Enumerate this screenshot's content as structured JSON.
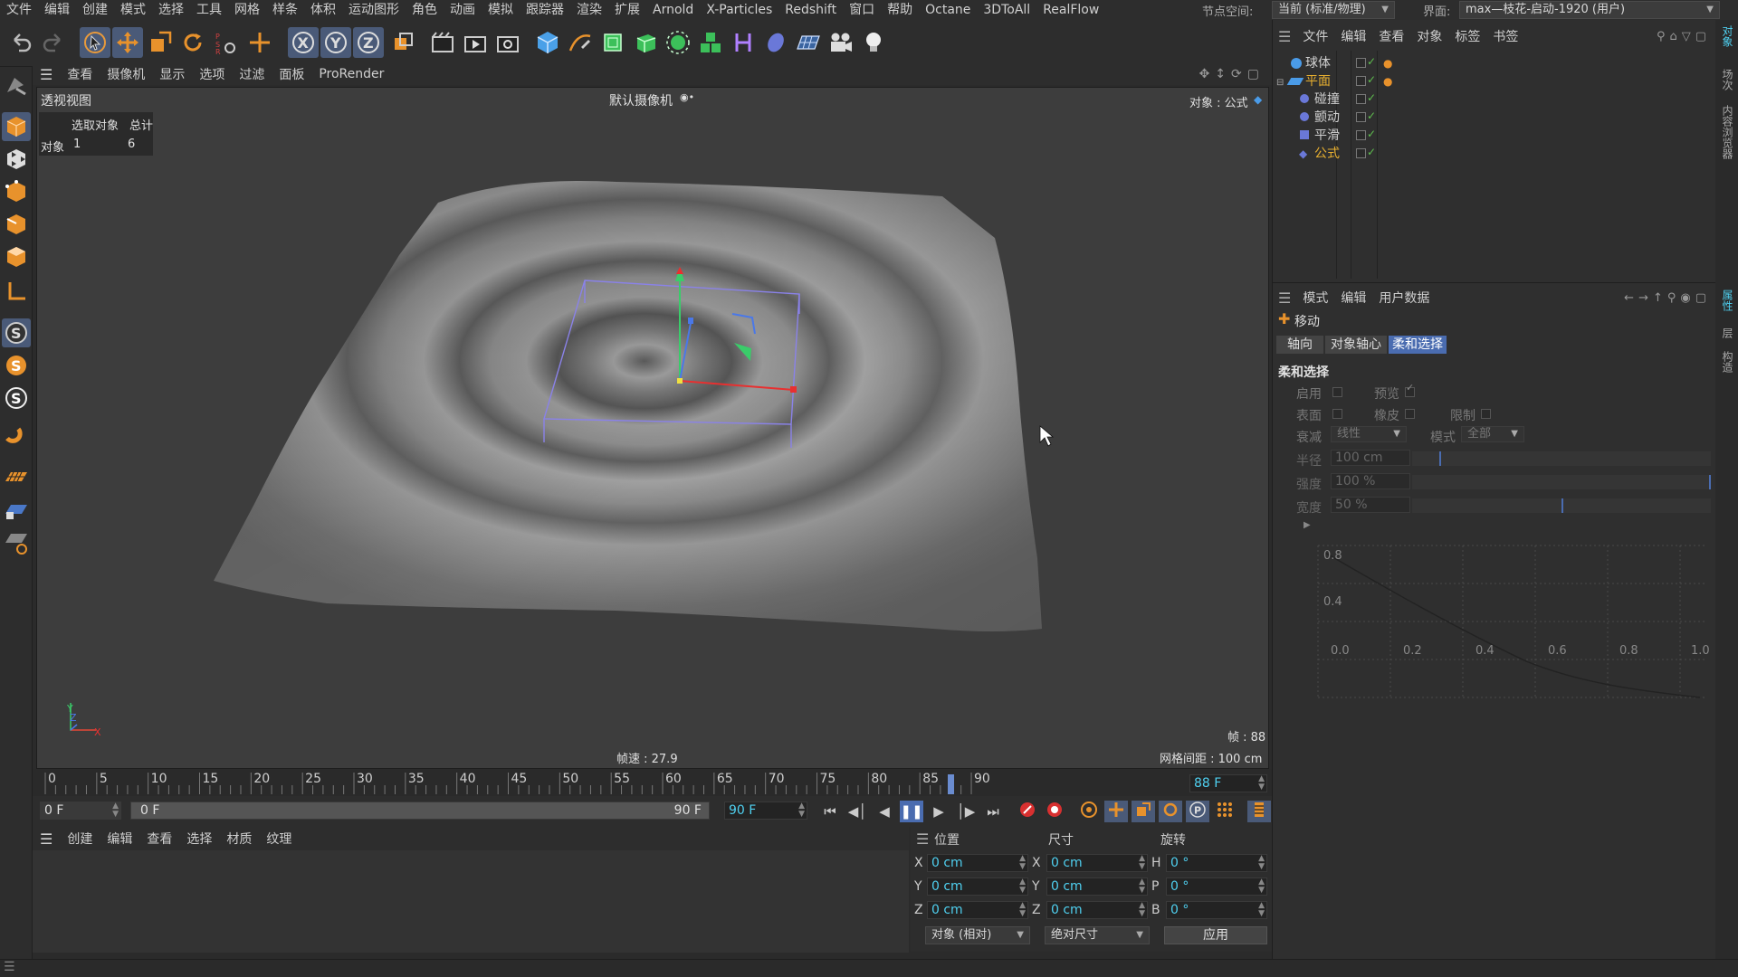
{
  "menubar": {
    "items": [
      "文件",
      "编辑",
      "创建",
      "模式",
      "选择",
      "工具",
      "网格",
      "样条",
      "体积",
      "运动图形",
      "角色",
      "动画",
      "模拟",
      "跟踪器",
      "渲染",
      "扩展",
      "Arnold",
      "X-Particles",
      "Redshift",
      "窗口",
      "帮助",
      "Octane",
      "3DToAll",
      "RealFlow"
    ],
    "node_space_label": "节点空间:",
    "node_space_value": "当前 (标准/物理)",
    "layout_label": "界面:",
    "layout_value": "max—枝花-启动-1920 (用户)"
  },
  "viewport_menu": {
    "items": [
      "查看",
      "摄像机",
      "显示",
      "选项",
      "过滤",
      "面板",
      "ProRender"
    ]
  },
  "viewport": {
    "view_name": "透视视图",
    "camera": "默认摄像机",
    "object_label": "对象 : 公式",
    "stats_header_selected": "选取对象",
    "stats_header_total": "总计",
    "stats_row_label": "对象",
    "stats_selected": "1",
    "stats_total": "6",
    "fps": "帧速 : 27.9",
    "frame": "帧 : 88",
    "grid_spacing": "网格间距 : 100 cm",
    "axis_y": "Y",
    "axis_z": "Z",
    "axis_x": "X"
  },
  "timeline": {
    "ticks": [
      "0",
      "5",
      "10",
      "15",
      "20",
      "25",
      "30",
      "35",
      "40",
      "45",
      "50",
      "55",
      "60",
      "65",
      "70",
      "75",
      "80",
      "85",
      "90"
    ],
    "current_frame": "88 F",
    "current_frame_value": 88,
    "frame_max_value": 90
  },
  "transport": {
    "start": "0 F",
    "range_start": "0 F",
    "range_end": "90 F",
    "end": "90 F"
  },
  "material_menu": {
    "items": [
      "创建",
      "编辑",
      "查看",
      "选择",
      "材质",
      "纹理"
    ]
  },
  "coords": {
    "header_position": "位置",
    "header_size": "尺寸",
    "header_rotation": "旋转",
    "rows": [
      {
        "pl": "X",
        "pv": "0 cm",
        "sl": "X",
        "sv": "0 cm",
        "rl": "H",
        "rv": "0 °"
      },
      {
        "pl": "Y",
        "pv": "0 cm",
        "sl": "Y",
        "sv": "0 cm",
        "rl": "P",
        "rv": "0 °"
      },
      {
        "pl": "Z",
        "pv": "0 cm",
        "sl": "Z",
        "sv": "0 cm",
        "rl": "B",
        "rv": "0 °"
      }
    ],
    "mode_select": "对象 (相对)",
    "size_select": "绝对尺寸",
    "apply": "应用"
  },
  "objmgr": {
    "menu": [
      "文件",
      "编辑",
      "查看",
      "对象",
      "标签",
      "书签"
    ],
    "objects": [
      {
        "name": "球体",
        "color": "#d0d0d0"
      },
      {
        "name": "平面",
        "color": "#e8b030"
      },
      {
        "name": "碰撞",
        "color": "#d0d0d0"
      },
      {
        "name": "颤动",
        "color": "#d0d0d0"
      },
      {
        "name": "平滑",
        "color": "#d0d0d0"
      },
      {
        "name": "公式",
        "color": "#e8b030"
      }
    ]
  },
  "attrmgr": {
    "menu": [
      "模式",
      "编辑",
      "用户数据"
    ],
    "tool_name": "移动",
    "tabs": [
      "轴向",
      "对象轴心",
      "柔和选择"
    ],
    "section": "柔和选择",
    "enable": "启用",
    "preview": "预览",
    "surface": "表面",
    "rubber": "橡皮",
    "limit": "限制",
    "falloff_label": "衰减",
    "falloff_value": "线性",
    "mode_label": "模式",
    "mode_value": "全部",
    "radius_label": "半径",
    "radius_value": "100 cm",
    "strength_label": "强度",
    "strength_value": "100 %",
    "width_label": "宽度",
    "width_value": "50 %",
    "graph_y": [
      "0.8",
      "0.4"
    ],
    "graph_x": [
      "0.0",
      "0.2",
      "0.4",
      "0.6",
      "0.8",
      "1.0"
    ]
  },
  "right_tabs": [
    "对象",
    "场次",
    "内容浏览器",
    "属性",
    "层",
    "构造"
  ]
}
